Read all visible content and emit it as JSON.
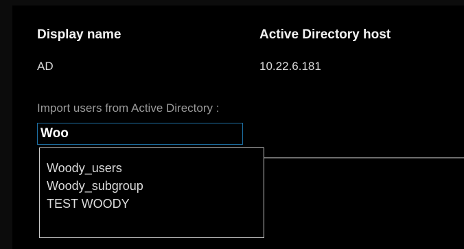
{
  "directory": {
    "display_name_header": "Display name",
    "host_header": "Active Directory host",
    "display_name_value": "AD",
    "host_value": "10.22.6.181"
  },
  "import": {
    "label": "Import users from Active Directory :",
    "search_value": "Woo",
    "suggestions": [
      "Woody_users",
      "Woody_subgroup",
      "TEST WOODY"
    ]
  },
  "colors": {
    "background": "#000000",
    "input_border": "#1d6fa3",
    "dropdown_border": "#c8c8c8"
  }
}
